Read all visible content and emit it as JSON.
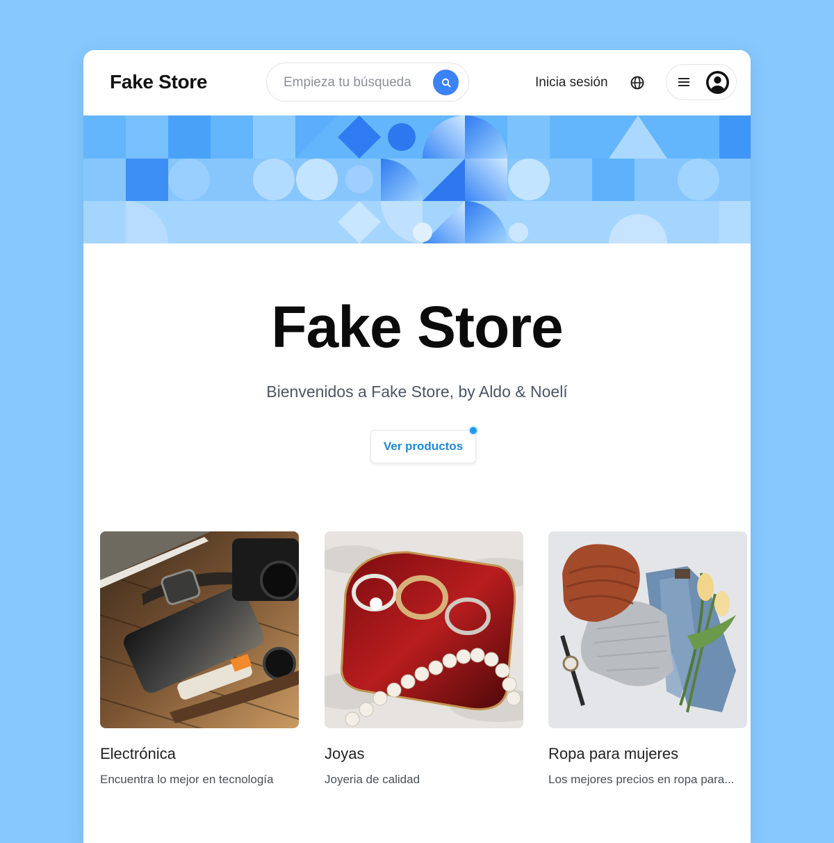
{
  "header": {
    "logo": "Fake Store",
    "search_placeholder": "Empieza tu búsqueda",
    "search_icon": "search-icon",
    "login_label": "Inicia sesión",
    "language_icon": "globe-icon",
    "menu_icon": "menu-icon",
    "avatar_icon": "user-avatar-icon"
  },
  "hero": {
    "title": "Fake Store",
    "subtitle": "Bienvenidos a Fake Store, by Aldo & Noelí",
    "cta_label": "Ver productos"
  },
  "categories": [
    {
      "title": "Electrónica",
      "description": "Encuentra lo mejor en tecnología"
    },
    {
      "title": "Joyas",
      "description": "Joyeria de calidad"
    },
    {
      "title": "Ropa para mujeres",
      "description": "Los mejores precios en ropa para..."
    }
  ],
  "colors": {
    "page_background": "#87c9fd",
    "accent": "#3b82f6",
    "cta_text": "#1e88d8",
    "banner_primary": "#4fa3ff"
  }
}
